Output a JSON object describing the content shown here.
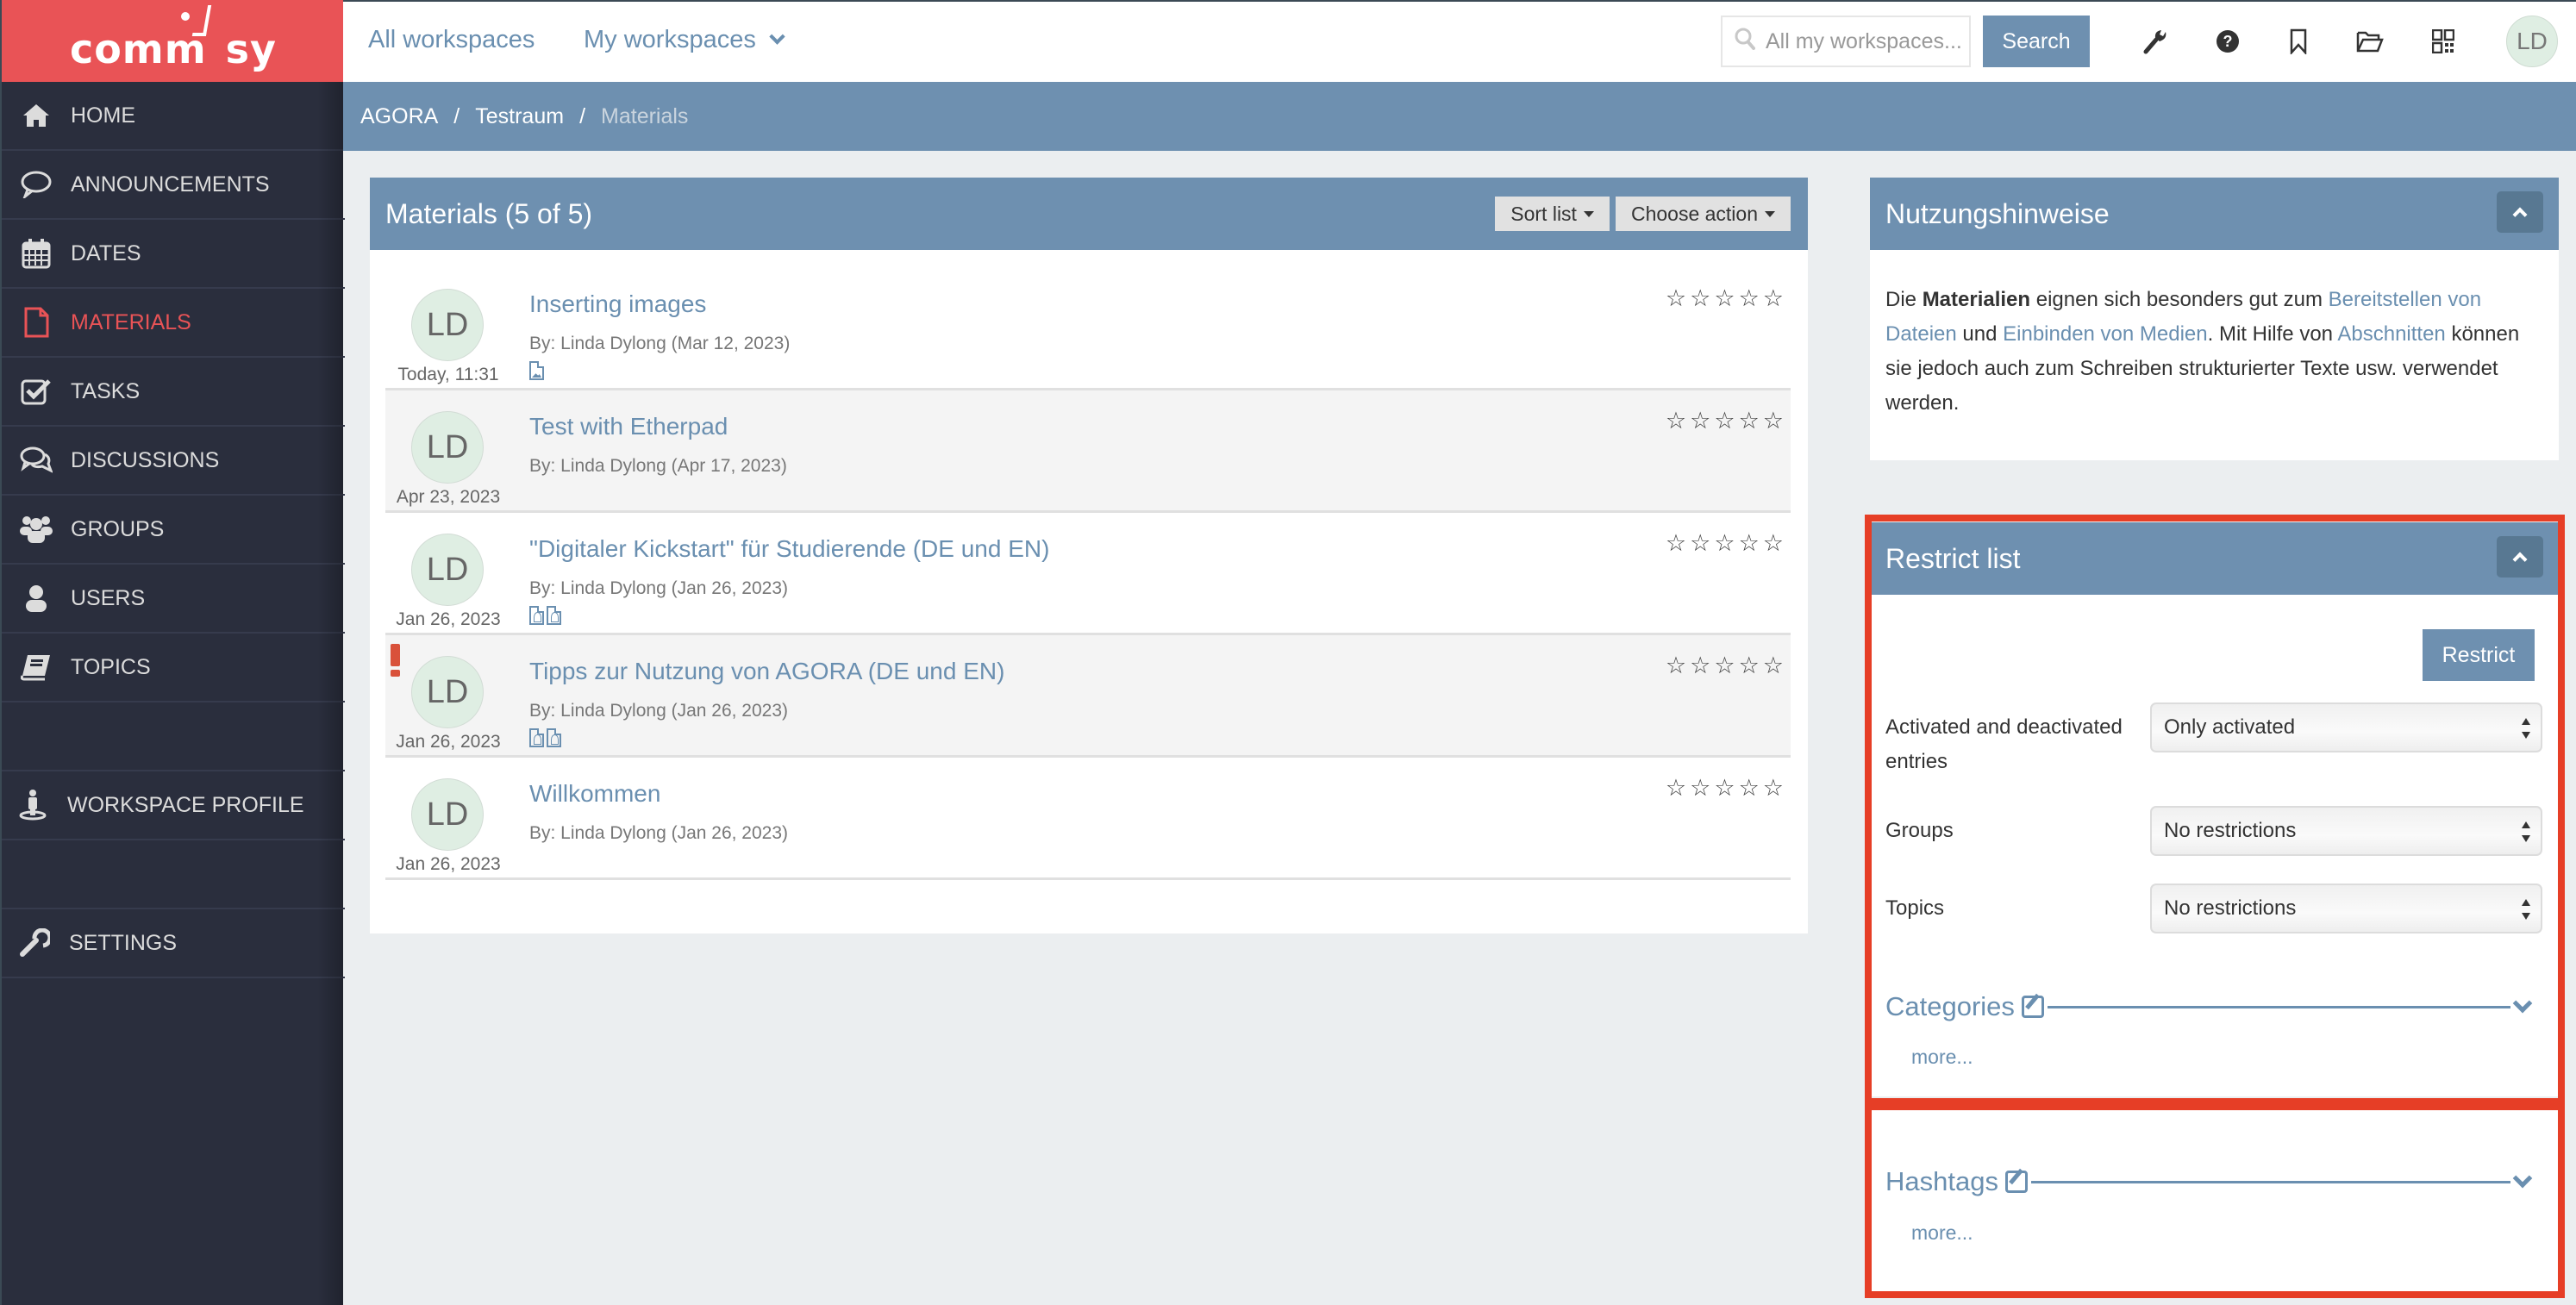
{
  "app": {
    "logo_text": "comm sy"
  },
  "sidebar": {
    "items": [
      {
        "label": "HOME",
        "icon": "home-icon"
      },
      {
        "label": "ANNOUNCEMENTS",
        "icon": "speech-bubble-icon"
      },
      {
        "label": "DATES",
        "icon": "calendar-icon"
      },
      {
        "label": "MATERIALS",
        "icon": "file-icon",
        "active": true
      },
      {
        "label": "TASKS",
        "icon": "checkbox-icon"
      },
      {
        "label": "DISCUSSIONS",
        "icon": "comments-icon"
      },
      {
        "label": "GROUPS",
        "icon": "group-icon"
      },
      {
        "label": "USERS",
        "icon": "user-icon"
      },
      {
        "label": "TOPICS",
        "icon": "book-icon"
      },
      {
        "label": "WORKSPACE PROFILE",
        "icon": "street-view-icon"
      },
      {
        "label": "SETTINGS",
        "icon": "wrench-icon"
      }
    ]
  },
  "topbar": {
    "all_workspaces": "All workspaces",
    "my_workspaces": "My workspaces",
    "search_placeholder": "All my workspaces...",
    "search_button": "Search",
    "user_initials": "LD",
    "icons": [
      "wrench-icon",
      "help-icon",
      "bookmark-icon",
      "folder-open-icon",
      "qr-code-icon"
    ]
  },
  "breadcrumb": [
    "AGORA",
    "Testraum",
    "Materials"
  ],
  "materials": {
    "title": "Materials (5 of 5)",
    "sort_button": "Sort list",
    "action_button": "Choose action",
    "items": [
      {
        "initials": "LD",
        "date": "Today, 11:31",
        "title": "Inserting images",
        "by": "By: Linda Dylong (Mar 12, 2023)",
        "files": [
          "image"
        ],
        "rating": 0,
        "flagged": false
      },
      {
        "initials": "LD",
        "date": "Apr 23, 2023",
        "title": "Test with Etherpad",
        "by": "By: Linda Dylong (Apr 17, 2023)",
        "files": [],
        "rating": 0,
        "flagged": false
      },
      {
        "initials": "LD",
        "date": "Jan 26, 2023",
        "title": "\"Digitaler Kickstart\" für Studierende (DE und EN)",
        "by": "By: Linda Dylong (Jan 26, 2023)",
        "files": [
          "pdf",
          "pdf"
        ],
        "rating": 0,
        "flagged": false
      },
      {
        "initials": "LD",
        "date": "Jan 26, 2023",
        "title": "Tipps zur Nutzung von AGORA (DE und EN)",
        "by": "By: Linda Dylong (Jan 26, 2023)",
        "files": [
          "pdf",
          "pdf"
        ],
        "rating": 0,
        "flagged": true
      },
      {
        "initials": "LD",
        "date": "Jan 26, 2023",
        "title": "Willkommen",
        "by": "By: Linda Dylong (Jan 26, 2023)",
        "files": [],
        "rating": 0,
        "flagged": false
      }
    ]
  },
  "hints": {
    "title": "Nutzungshinweise",
    "text_1": "Die ",
    "bold_1": "Materialien",
    "text_2": " eignen sich besonders gut zum ",
    "link_1": "Bereitstellen von Dateien",
    "text_3": " und ",
    "link_2": "Einbinden von Medien",
    "text_4": ". Mit Hilfe von ",
    "link_3": "Abschnitten",
    "text_5": " können sie jedoch auch zum Schreiben strukturierter Texte usw. verwendet werden."
  },
  "restrict": {
    "title": "Restrict list",
    "button": "Restrict",
    "fields": [
      {
        "label": "Activated and deactivated entries",
        "value": "Only activated"
      },
      {
        "label": "Groups",
        "value": "No restrictions"
      },
      {
        "label": "Topics",
        "value": "No restrictions"
      }
    ],
    "categories_title": "Categories",
    "categories_more": "more...",
    "hashtags_title": "Hashtags",
    "hashtags_more": "more..."
  },
  "colors": {
    "brand_red": "#e95356",
    "accent_blue": "#6e90b0",
    "highlight_red": "#e63e26",
    "sidebar_bg": "#2a2e3d"
  }
}
